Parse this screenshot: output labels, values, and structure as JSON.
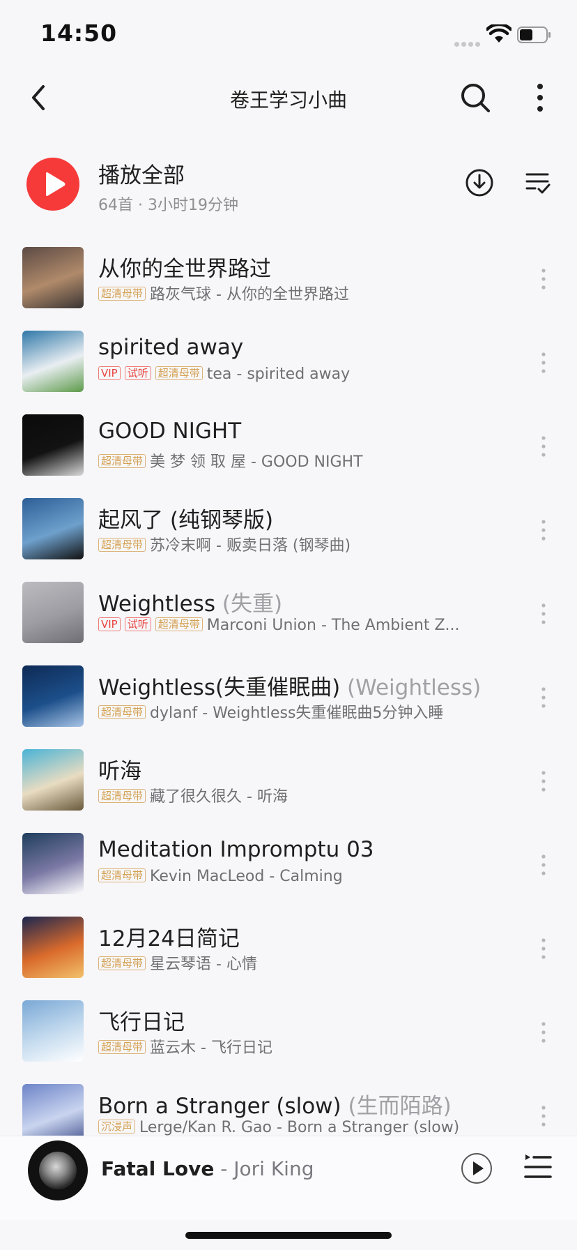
{
  "status_bar": {
    "time": "14:50"
  },
  "nav": {
    "title": "卷王学习小曲"
  },
  "play_all": {
    "title": "播放全部",
    "meta": "64首 · 3小时19分钟"
  },
  "songs": [
    {
      "title": "从你的全世界路过",
      "alias": "",
      "tags": [
        "超清母带"
      ],
      "artist_album": "路灰气球 - 从你的全世界路过",
      "cover_colors": [
        "#5c4a45",
        "#b08a6a",
        "#3a3433"
      ]
    },
    {
      "title": "spirited away",
      "alias": "",
      "tags": [
        "VIP",
        "试听",
        "超清母带"
      ],
      "artist_album": "tea - spirited away",
      "cover_colors": [
        "#2f78a8",
        "#e9eef2",
        "#5d9a4a"
      ]
    },
    {
      "title": "GOOD NIGHT",
      "alias": "",
      "tags": [
        "超清母带"
      ],
      "artist_album": "美 梦 领 取 屋 - GOOD NIGHT",
      "cover_colors": [
        "#0a0a0a",
        "#121212",
        "#d9d9d9"
      ]
    },
    {
      "title": "起风了 (纯钢琴版)",
      "alias": "",
      "tags": [
        "超清母带"
      ],
      "artist_album": "苏冷末啊 - 贩卖日落 (钢琴曲)",
      "cover_colors": [
        "#2d5e97",
        "#6ea0cc",
        "#111111"
      ]
    },
    {
      "title": "Weightless",
      "alias": " (失重)",
      "tags": [
        "VIP",
        "试听",
        "超清母带"
      ],
      "artist_album": "Marconi Union - The Ambient Z...",
      "cover_colors": [
        "#bcbcc0",
        "#9c9ca2",
        "#6e6e74"
      ]
    },
    {
      "title": "Weightless(失重催眠曲)",
      "alias": " (Weightless)",
      "tags": [
        "超清母带"
      ],
      "artist_album": "dylanf - Weightless失重催眠曲5分钟入睡",
      "cover_colors": [
        "#0e2a55",
        "#1c4f8a",
        "#a8c4e6"
      ]
    },
    {
      "title": "听海",
      "alias": "",
      "tags": [
        "超清母带"
      ],
      "artist_album": "藏了很久很久 - 听海",
      "cover_colors": [
        "#4ab3d6",
        "#e8dcc2",
        "#6a5a3c"
      ]
    },
    {
      "title": "Meditation Impromptu 03",
      "alias": "",
      "tags": [
        "超清母带"
      ],
      "artist_album": "Kevin MacLeod - Calming",
      "cover_colors": [
        "#1e3e5c",
        "#7a78a4",
        "#ffffff"
      ]
    },
    {
      "title": "12月24日简记",
      "alias": "",
      "tags": [
        "超清母带"
      ],
      "artist_album": "星云琴语 - 心情",
      "cover_colors": [
        "#1b2650",
        "#d96a2c",
        "#f2c16a"
      ]
    },
    {
      "title": "飞行日记",
      "alias": "",
      "tags": [
        "超清母带"
      ],
      "artist_album": "蓝云木 - 飞行日记",
      "cover_colors": [
        "#7aa8d6",
        "#c6dcef",
        "#ffffff"
      ]
    },
    {
      "title": "Born a Stranger (slow)",
      "alias": " (生而陌路)",
      "tags": [
        "沉浸声"
      ],
      "artist_album": "Lerge/Kan R. Gao - Born a Stranger (slow)",
      "cover_colors": [
        "#6d84c8",
        "#c9d4ef",
        "#3b4a86"
      ]
    }
  ],
  "now_playing": {
    "title": "Fatal Love",
    "separator": " - ",
    "artist": "Jori King"
  },
  "colors": {
    "accent": "#f63a3a",
    "tag_gold": "#d4a052",
    "tag_red": "#e8433f"
  }
}
